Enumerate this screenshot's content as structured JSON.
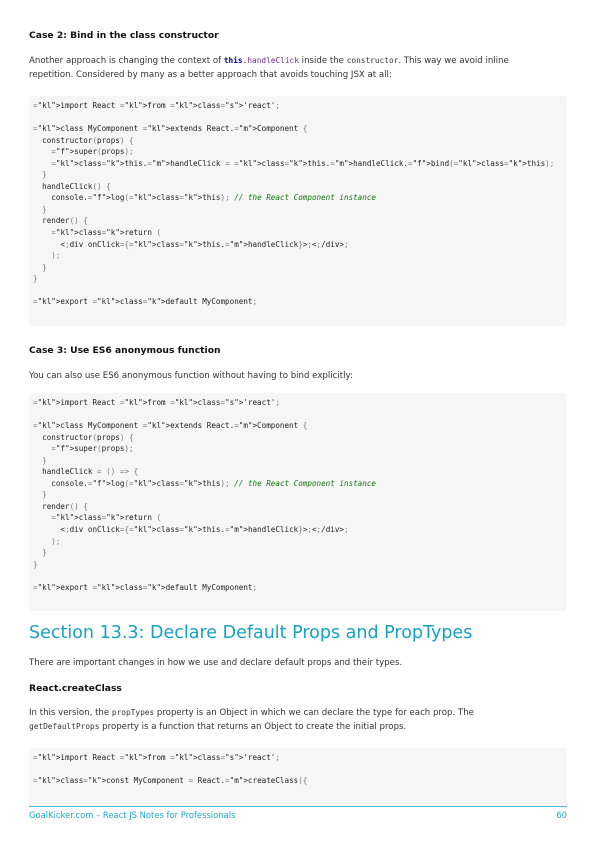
{
  "case2": {
    "heading": "Case 2: Bind in the class constructor",
    "p_a": "Another approach is changing the context of ",
    "p_this": "this",
    "p_dot": ".",
    "p_handle": "handleClick",
    "p_b": " inside the ",
    "p_ctor": "constructor",
    "p_c": ". This way we avoid inline",
    "p_line2": "repetition. Considered by many as a better approach that avoids touching JSX at all:"
  },
  "code1": {
    "lines": [
      "import React from 'react';",
      "",
      "class MyComponent extends React.Component {",
      "  constructor(props) {",
      "    super(props);",
      "    this.handleClick = this.handleClick.bind(this);",
      "  }",
      "  handleClick() {",
      "    console.log(this); // the React Component instance",
      "  }",
      "  render() {",
      "    return (",
      "      <div onClick={this.handleClick}></div>",
      "    );",
      "  }",
      "}",
      "",
      "export default MyComponent;"
    ]
  },
  "case3": {
    "heading": "Case 3: Use ES6 anonymous function",
    "para": "You can also use ES6 anonymous function without having to bind explicitly:"
  },
  "code2": {
    "lines": [
      "import React from 'react';",
      "",
      "class MyComponent extends React.Component {",
      "  constructor(props) {",
      "    super(props);",
      "  }",
      "  handleClick = () => {",
      "    console.log(this); // the React Component instance",
      "  }",
      "  render() {",
      "    return (",
      "      <div onClick={this.handleClick}></div>",
      "    );",
      "  }",
      "}",
      "",
      "export default MyComponent;"
    ]
  },
  "section": {
    "title": "Section 13.3: Declare Default Props and PropTypes",
    "intro": "There are important changes in how we use and declare default props and their types.",
    "sub_heading": "React.createClass",
    "p_a": "In this version, the ",
    "p_proptypes": "propTypes",
    "p_b": " property is an Object in which we can declare the type for each prop. The",
    "p_getdefault": "getDefaultProps",
    "p_c": " property is a function that returns an Object to create the initial props."
  },
  "code3": {
    "lines": [
      "import React from 'react';",
      "",
      "const MyComponent = React.createClass({"
    ]
  },
  "footer": {
    "left": "GoalKicker.com – React JS Notes for Professionals",
    "page": "60"
  }
}
